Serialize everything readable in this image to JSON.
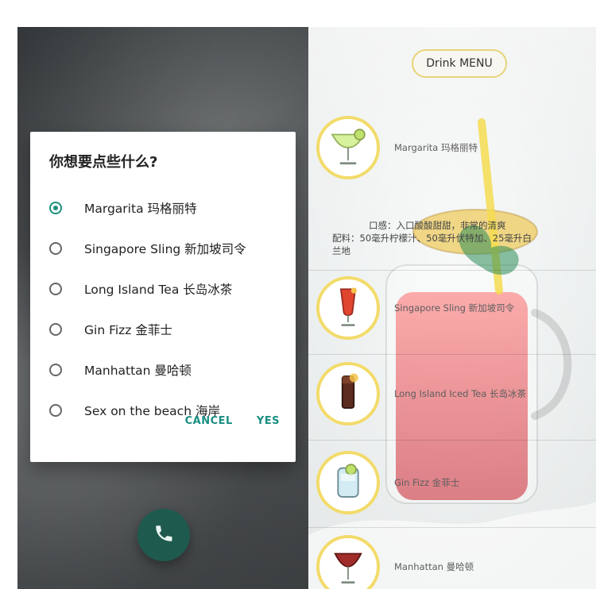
{
  "dialog": {
    "title": "你想要点些什么?",
    "options": [
      {
        "label": "Margarita 玛格丽特",
        "checked": true
      },
      {
        "label": "Singapore Sling 新加坡司令",
        "checked": false
      },
      {
        "label": "Long Island  Tea 长岛冰茶",
        "checked": false
      },
      {
        "label": "Gin Fizz 金菲士",
        "checked": false
      },
      {
        "label": "Manhattan 曼哈顿",
        "checked": false
      },
      {
        "label": "Sex on the beach 海岸",
        "checked": false
      }
    ],
    "actions": {
      "cancel": "CANCEL",
      "yes": "YES"
    }
  },
  "right": {
    "menu_pill": "Drink MENU",
    "drinks": [
      {
        "name": "Margarita  玛格丽特",
        "icon": "margarita-glass-icon"
      },
      {
        "name": "Singapore Sling  新加坡司令",
        "icon": "singapore-sling-glass-icon"
      },
      {
        "name": "Long Island Iced Tea  长岛冰茶",
        "icon": "long-island-iced-tea-glass-icon"
      },
      {
        "name": "Gin Fizz  金菲士",
        "icon": "gin-fizz-glass-icon"
      },
      {
        "name": "Manhattan  曼哈顿",
        "icon": "manhattan-glass-icon"
      }
    ],
    "description": {
      "line1": "口感：入口酸酸甜甜，非常的清爽",
      "line2": "配料：50毫升柠檬汁、50毫升伏特加、25毫升白",
      "line3": "兰地"
    }
  },
  "colors": {
    "accent": "#1a8f83",
    "thumb_border": "#f3db6a",
    "fab": "#1f5a4f"
  }
}
